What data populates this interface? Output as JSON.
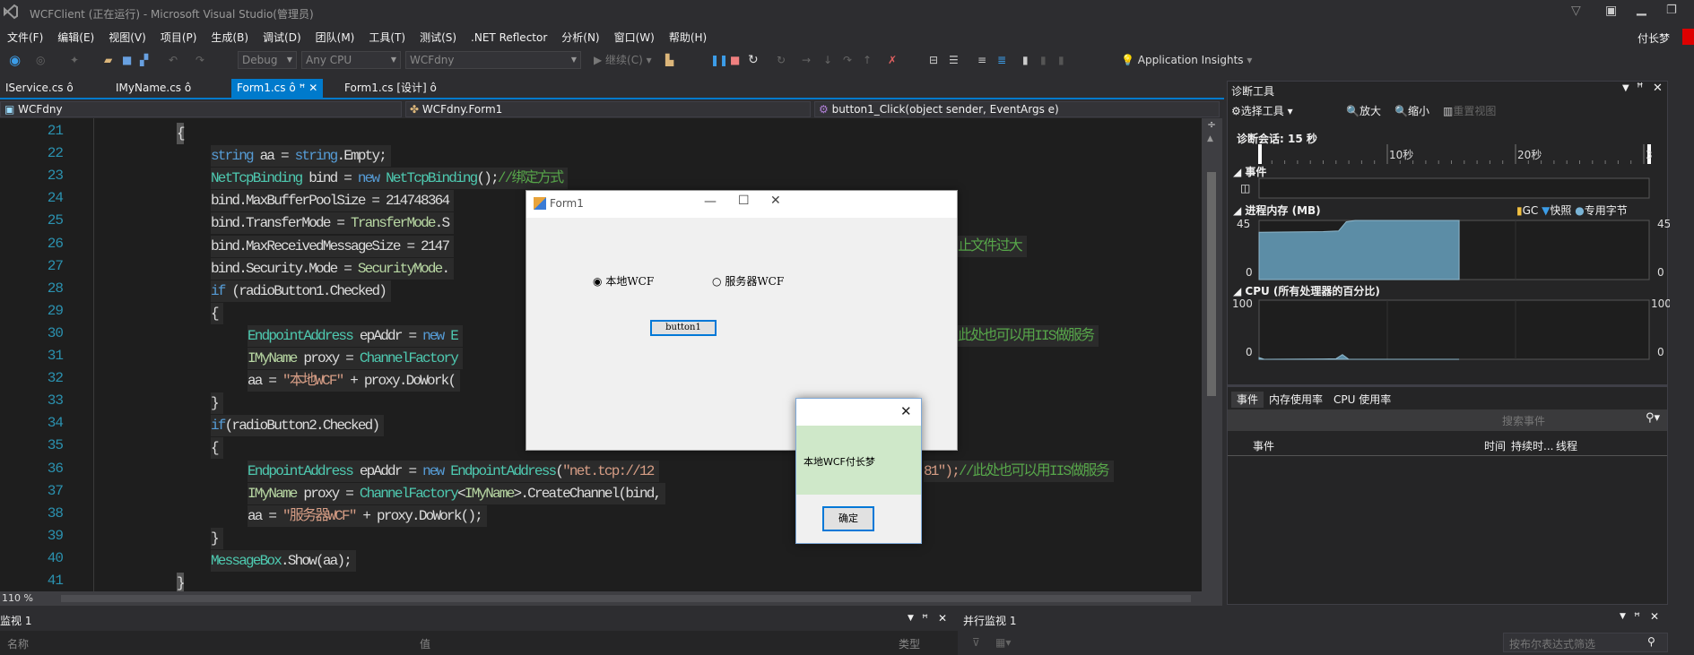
{
  "titlebar": {
    "title": "WCFClient (正在运行) - Microsoft Visual Studio(管理员)",
    "user": "付长梦",
    "icons": [
      "vs-logo-icon",
      "filter-icon",
      "feedback-icon",
      "minimize-icon",
      "restore-icon"
    ]
  },
  "menu": [
    "文件(F)",
    "编辑(E)",
    "视图(V)",
    "项目(P)",
    "生成(B)",
    "调试(D)",
    "团队(M)",
    "工具(T)",
    "测试(S)",
    ".NET Reflector",
    "分析(N)",
    "窗口(W)",
    "帮助(H)"
  ],
  "toolbar": {
    "config": "Debug",
    "platform": "Any CPU",
    "project": "WCFdny",
    "continue": "继续(C)",
    "app_insights": "Application Insights"
  },
  "tabs": [
    {
      "label": "IService.cs",
      "active": false
    },
    {
      "label": "IMyName.cs",
      "active": false
    },
    {
      "label": "Form1.cs",
      "active": true
    },
    {
      "label": "Form1.cs [设计]",
      "active": false
    }
  ],
  "navbar": {
    "project": "WCFdny",
    "class": "WCFdny.Form1",
    "member": "button1_Click(object sender, EventArgs e)"
  },
  "editor": {
    "zoom": "110 %",
    "lines": [
      {
        "n": "21",
        "indent": 0,
        "tokens": [
          {
            "t": "{",
            "c": "tx"
          }
        ]
      },
      {
        "n": "22",
        "indent": 1,
        "tokens": [
          {
            "t": "string",
            "c": "kw"
          },
          {
            "t": " aa = ",
            "c": "tx"
          },
          {
            "t": "string",
            "c": "kw"
          },
          {
            "t": ".Empty;",
            "c": "tx"
          }
        ]
      },
      {
        "n": "23",
        "indent": 1,
        "tokens": [
          {
            "t": "NetTcpBinding",
            "c": "ty"
          },
          {
            "t": " bind = ",
            "c": "tx"
          },
          {
            "t": "new",
            "c": "kw"
          },
          {
            "t": " ",
            "c": "tx"
          },
          {
            "t": "NetTcpBinding",
            "c": "ty"
          },
          {
            "t": "();",
            "c": "tx"
          },
          {
            "t": "//绑定方式",
            "c": "cm"
          }
        ]
      },
      {
        "n": "24",
        "indent": 1,
        "tokens": [
          {
            "t": "bind.MaxBufferPoolSize = 214748364",
            "c": "tx"
          }
        ]
      },
      {
        "n": "25",
        "indent": 1,
        "tokens": [
          {
            "t": "bind.TransferMode = ",
            "c": "tx"
          },
          {
            "t": "TransferMode",
            "c": "en"
          },
          {
            "t": ".S",
            "c": "tx"
          }
        ]
      },
      {
        "n": "26",
        "indent": 1,
        "tokens": [
          {
            "t": "bind.MaxReceivedMessageSize = 2147",
            "c": "tx"
          }
        ],
        "after": {
          "t": "止文件过大",
          "c": "cm"
        }
      },
      {
        "n": "27",
        "indent": 1,
        "tokens": [
          {
            "t": "bind.Security.Mode = ",
            "c": "tx"
          },
          {
            "t": "SecurityMode",
            "c": "en"
          },
          {
            "t": ".",
            "c": "tx"
          }
        ]
      },
      {
        "n": "28",
        "indent": 1,
        "tokens": [
          {
            "t": "if",
            "c": "kw"
          },
          {
            "t": " (radioButton1.Checked)",
            "c": "tx"
          }
        ]
      },
      {
        "n": "29",
        "indent": 1,
        "tokens": [
          {
            "t": "{",
            "c": "tx"
          }
        ]
      },
      {
        "n": "30",
        "indent": 2,
        "tokens": [
          {
            "t": "EndpointAddress",
            "c": "ty"
          },
          {
            "t": " epAddr = ",
            "c": "tx"
          },
          {
            "t": "new",
            "c": "kw"
          },
          {
            "t": " E",
            "c": "ty"
          }
        ],
        "after": {
          "t": "此处也可以用IIS做服务",
          "c": "cm"
        }
      },
      {
        "n": "31",
        "indent": 2,
        "tokens": [
          {
            "t": "IMyName",
            "c": "en"
          },
          {
            "t": " proxy = ",
            "c": "tx"
          },
          {
            "t": "ChannelFactory",
            "c": "ty"
          }
        ]
      },
      {
        "n": "32",
        "indent": 2,
        "tokens": [
          {
            "t": "aa = ",
            "c": "tx"
          },
          {
            "t": "\"本地WCF\"",
            "c": "st"
          },
          {
            "t": " + proxy.DoWork(",
            "c": "tx"
          }
        ]
      },
      {
        "n": "33",
        "indent": 1,
        "tokens": [
          {
            "t": "}",
            "c": "tx"
          }
        ]
      },
      {
        "n": "34",
        "indent": 1,
        "tokens": [
          {
            "t": "if",
            "c": "kw"
          },
          {
            "t": "(radioButton2.Checked)",
            "c": "tx"
          }
        ]
      },
      {
        "n": "35",
        "indent": 1,
        "tokens": [
          {
            "t": "{",
            "c": "tx"
          }
        ]
      },
      {
        "n": "36",
        "indent": 2,
        "tokens": [
          {
            "t": "EndpointAddress",
            "c": "ty"
          },
          {
            "t": " epAddr = ",
            "c": "tx"
          },
          {
            "t": "new",
            "c": "kw"
          },
          {
            "t": " ",
            "c": "tx"
          },
          {
            "t": "EndpointAddress",
            "c": "ty"
          },
          {
            "t": "(",
            "c": "tx"
          },
          {
            "t": "\"net.tcp://12",
            "c": "st"
          }
        ],
        "after2": {
          "t": "81\");",
          "c": "st",
          "cm": "//此处也可以用IIS做服务"
        }
      },
      {
        "n": "37",
        "indent": 2,
        "tokens": [
          {
            "t": "IMyName",
            "c": "en"
          },
          {
            "t": " proxy = ",
            "c": "tx"
          },
          {
            "t": "ChannelFactory",
            "c": "ty"
          },
          {
            "t": "<",
            "c": "tx"
          },
          {
            "t": "IMyName",
            "c": "en"
          },
          {
            "t": ">.CreateChannel(bind,",
            "c": "tx"
          }
        ]
      },
      {
        "n": "38",
        "indent": 2,
        "tokens": [
          {
            "t": "aa = ",
            "c": "tx"
          },
          {
            "t": "\"服务器WCF\"",
            "c": "st"
          },
          {
            "t": " + proxy.DoWork();",
            "c": "tx"
          }
        ]
      },
      {
        "n": "39",
        "indent": 1,
        "tokens": [
          {
            "t": "}",
            "c": "tx"
          }
        ]
      },
      {
        "n": "40",
        "indent": 1,
        "tokens": [
          {
            "t": "MessageBox",
            "c": "ty"
          },
          {
            "t": ".Show(aa);",
            "c": "tx"
          }
        ]
      },
      {
        "n": "41",
        "indent": 0,
        "tokens": [
          {
            "t": "}",
            "c": "tx"
          }
        ]
      }
    ]
  },
  "form1": {
    "title": "Form1",
    "radio1": {
      "label": "本地WCF",
      "checked": true
    },
    "radio2": {
      "label": "服务器WCF",
      "checked": false
    },
    "button": "button1"
  },
  "messagebox": {
    "text": "本地WCF付长梦",
    "ok": "确定"
  },
  "diagnostics": {
    "title": "诊断工具",
    "select_tools": "选择工具",
    "zoom_in": "放大",
    "zoom_out": "缩小",
    "reset_view": "重置视图",
    "session": "诊断会话: 15 秒",
    "timeline_ticks": [
      "10秒",
      "20秒",
      "3"
    ],
    "events_label": "事件",
    "memory": {
      "label": "进程内存 (MB)",
      "legend": [
        "GC",
        "快照",
        "专用字节"
      ],
      "ymax": "45",
      "ymin": "0",
      "series_seconds_mb": [
        [
          0,
          36
        ],
        [
          5,
          36.5
        ],
        [
          6.2,
          37
        ],
        [
          6.8,
          44
        ],
        [
          7.5,
          45
        ],
        [
          15.6,
          45
        ]
      ],
      "color": "#5c8da6"
    },
    "cpu": {
      "label": "CPU (所有处理器的百分比)",
      "ymax": "100",
      "ymin": "0",
      "series_seconds_pct": [
        [
          0,
          3
        ],
        [
          0.4,
          0
        ],
        [
          5,
          0.5
        ],
        [
          6,
          1
        ],
        [
          6.5,
          8
        ],
        [
          7,
          0
        ],
        [
          15.6,
          0
        ]
      ]
    },
    "tabs": [
      "事件",
      "内存使用率",
      "CPU 使用率"
    ],
    "search_placeholder": "搜索事件",
    "columns": [
      "事件",
      "时间",
      "持续时...",
      "线程"
    ]
  },
  "watch": {
    "title": "监视 1",
    "columns": [
      "名称",
      "值",
      "类型"
    ]
  },
  "parallel_watch": {
    "title": "并行监视 1",
    "filter_placeholder": "按布尔表达式筛选"
  }
}
